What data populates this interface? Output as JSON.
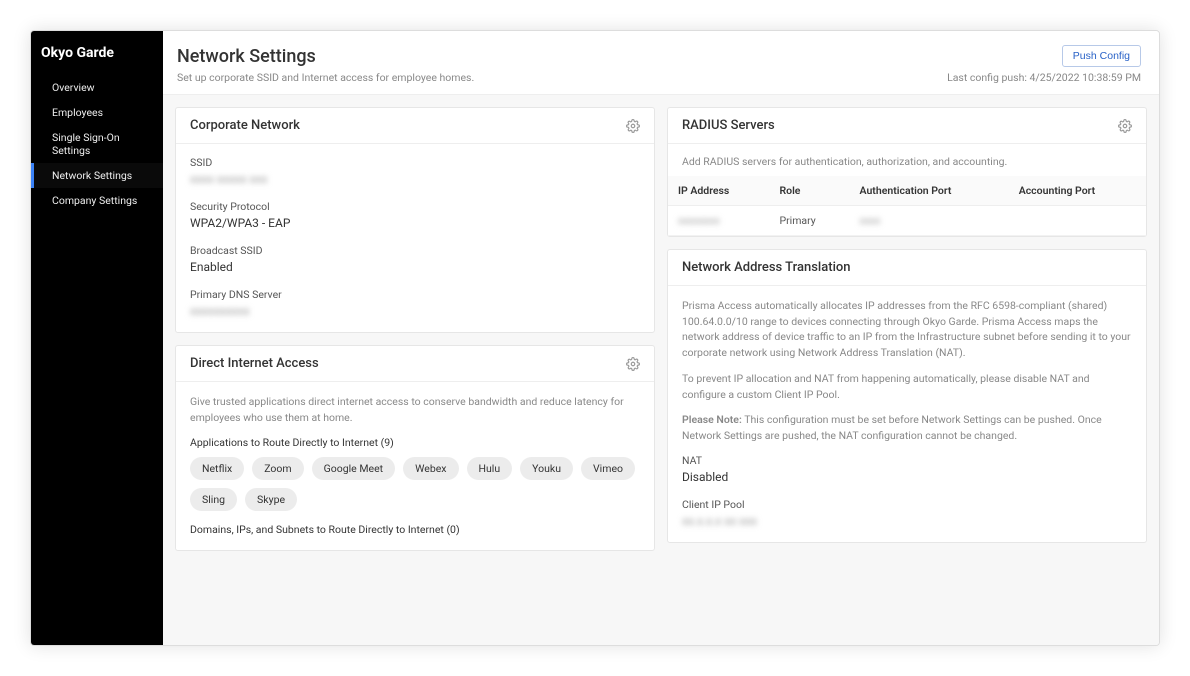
{
  "brand": "Okyo Garde",
  "sidebar": {
    "items": [
      {
        "label": "Overview"
      },
      {
        "label": "Employees"
      },
      {
        "label": "Single Sign-On Settings"
      },
      {
        "label": "Network Settings"
      },
      {
        "label": "Company Settings"
      }
    ]
  },
  "header": {
    "title": "Network Settings",
    "subtitle": "Set up corporate SSID and Internet access for employee homes.",
    "push_button": "Push Config",
    "last_push": "Last config push: 4/25/2022 10:38:59 PM"
  },
  "corporate_network": {
    "title": "Corporate Network",
    "ssid_label": "SSID",
    "ssid_value": "xxxx xxxxx xxx",
    "security_label": "Security Protocol",
    "security_value": "WPA2/WPA3 - EAP",
    "broadcast_label": "Broadcast SSID",
    "broadcast_value": "Enabled",
    "dns_label": "Primary DNS Server",
    "dns_value": "xxxxxxxxxx"
  },
  "direct_internet": {
    "title": "Direct Internet Access",
    "help": "Give trusted applications direct internet access to conserve bandwidth and reduce latency for employees who use them at home.",
    "apps_label": "Applications to Route Directly to Internet (9)",
    "apps": [
      "Netflix",
      "Zoom",
      "Google Meet",
      "Webex",
      "Hulu",
      "Youku",
      "Vimeo",
      "Sling",
      "Skype"
    ],
    "domains_label": "Domains, IPs, and Subnets to Route Directly to Internet (0)"
  },
  "radius": {
    "title": "RADIUS Servers",
    "help": "Add RADIUS servers for authentication, authorization, and accounting.",
    "headers": {
      "ip": "IP Address",
      "role": "Role",
      "auth": "Authentication Port",
      "acct": "Accounting Port"
    },
    "row": {
      "ip": "xxxxxxxx",
      "role": "Primary",
      "auth": "xxxx",
      "acct": ""
    }
  },
  "nat": {
    "title": "Network Address Translation",
    "p1": "Prisma Access automatically allocates IP addresses from the RFC 6598-compliant (shared) 100.64.0.0/10 range to devices connecting through Okyo Garde. Prisma Access maps the network address of device traffic to an IP from the Infrastructure subnet before sending it to your corporate network using Network Address Translation (NAT).",
    "p2": "To prevent IP allocation and NAT from happening automatically, please disable NAT and configure a custom Client IP Pool.",
    "note_label": "Please Note:",
    "note_text": "This configuration must be set before Network Settings can be pushed. Once Network Settings are pushed, the NAT configuration cannot be changed.",
    "nat_label": "NAT",
    "nat_value": "Disabled",
    "pool_label": "Client IP Pool",
    "pool_value": "xx.x.x.x xx xxx"
  }
}
